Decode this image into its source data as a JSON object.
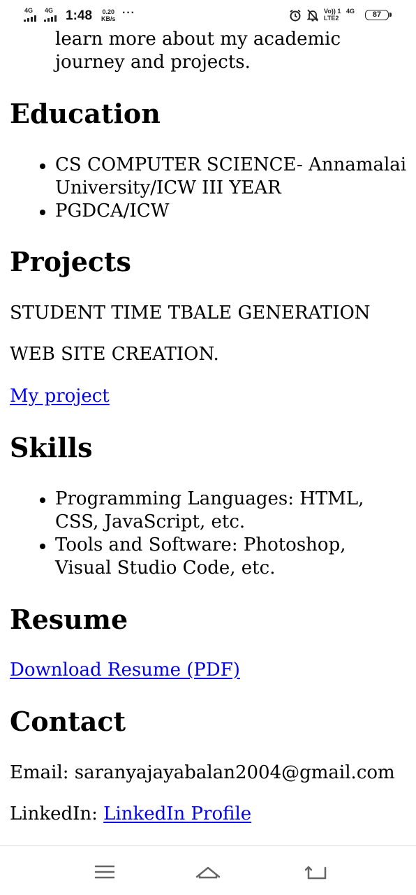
{
  "status_bar": {
    "sim1_network": "4G",
    "sim2_network": "4G",
    "time": "1:48",
    "speed_value": "0.20",
    "speed_unit": "KB/s",
    "overflow": "···",
    "volte_line1": "Vo)) 1",
    "volte_line2": "LTE2",
    "network_type": "4G",
    "battery_level": "87",
    "icons": [
      "signal-icon",
      "alarm-icon",
      "mute-icon",
      "battery-icon"
    ]
  },
  "page": {
    "intro_line1": "learn more about my academic",
    "intro_line2": "journey and projects.",
    "education": {
      "heading": "Education",
      "items": [
        {
          "line1": "CS COMPUTER SCIENCE- Annamalai",
          "line2": "University/ICW III YEAR"
        },
        {
          "line1": "PGDCA/ICW"
        }
      ]
    },
    "projects": {
      "heading": "Projects",
      "items": [
        "STUDENT TIME TBALE GENERATION",
        "WEB SITE CREATION."
      ],
      "link": "My project"
    },
    "skills": {
      "heading": "Skills",
      "items": [
        {
          "line1": "Programming Languages: HTML,",
          "line2": "CSS, JavaScript, etc."
        },
        {
          "line1": "Tools and Software: Photoshop,",
          "line2": "Visual Studio Code, etc."
        }
      ]
    },
    "resume": {
      "heading": "Resume",
      "link": "Download Resume (PDF)"
    },
    "contact": {
      "heading": "Contact",
      "email_label": "Email: ",
      "email": "saranyajayabalan2004@gmail.com",
      "linkedin_label": "LinkedIn: ",
      "linkedin_link": "LinkedIn Profile"
    }
  },
  "nav_bar": {
    "buttons": [
      "menu-icon",
      "home-icon",
      "back-icon"
    ]
  },
  "colors": {
    "link": "#0000ee",
    "text": "#000000",
    "background": "#ffffff"
  }
}
